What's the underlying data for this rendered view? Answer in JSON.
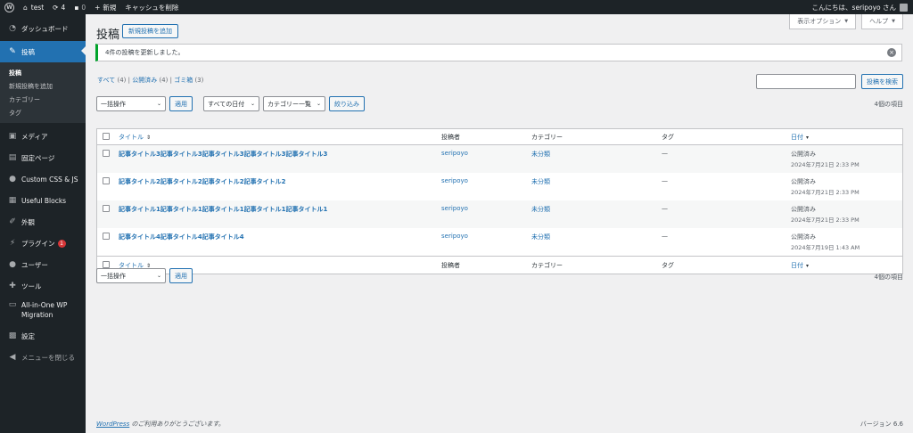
{
  "adminbar": {
    "site_name": "test",
    "updates_count": "4",
    "comments_count": "0",
    "new_label": "新規",
    "cache_label": "キャッシュを削除",
    "greeting": "こんにちは、seripoyo さん"
  },
  "sidebar": {
    "items": [
      {
        "label": "ダッシュボード",
        "icon": "dashboard-icon"
      },
      {
        "label": "投稿",
        "icon": "pin-icon"
      },
      {
        "label": "メディア",
        "icon": "media-icon"
      },
      {
        "label": "固定ページ",
        "icon": "page-icon"
      },
      {
        "label": "Custom CSS & JS",
        "icon": "code-icon"
      },
      {
        "label": "Useful Blocks",
        "icon": "blocks-icon"
      },
      {
        "label": "外観",
        "icon": "brush-icon"
      },
      {
        "label": "プラグイン",
        "icon": "plugin-icon",
        "badge": "1"
      },
      {
        "label": "ユーザー",
        "icon": "user-icon"
      },
      {
        "label": "ツール",
        "icon": "wrench-icon"
      },
      {
        "label": "All-in-One WP Migration",
        "icon": "migration-icon"
      },
      {
        "label": "設定",
        "icon": "settings-icon"
      }
    ],
    "submenu": [
      "投稿",
      "新規投稿を追加",
      "カテゴリー",
      "タグ"
    ],
    "collapse_label": "メニューを閉じる"
  },
  "header": {
    "title": "投稿",
    "add_new": "新規投稿を追加",
    "screen_options": "表示オプション",
    "help": "ヘルプ"
  },
  "notice": {
    "text": "4件の投稿を更新しました。"
  },
  "filters": {
    "all": "すべて",
    "all_count": "(4)",
    "published": "公開済み",
    "published_count": "(4)",
    "trash": "ゴミ箱",
    "trash_count": "(3)",
    "search_button": "投稿を検索",
    "bulk_action": "一括操作",
    "apply": "適用",
    "all_dates": "すべての日付",
    "category_select": "カテゴリー一覧",
    "filter_button": "絞り込み",
    "items_count": "4個の項目"
  },
  "table": {
    "columns": {
      "title": "タイトル",
      "author": "投稿者",
      "category": "カテゴリー",
      "tags": "タグ",
      "date": "日付"
    },
    "rows": [
      {
        "title": "記事タイトル3記事タイトル3記事タイトル3記事タイトル3記事タイトル3",
        "author": "seripoyo",
        "category": "未分類",
        "tags": "—",
        "status": "公開済み",
        "date": "2024年7月21日 2:33 PM"
      },
      {
        "title": "記事タイトル2記事タイトル2記事タイトル2記事タイトル2",
        "author": "seripoyo",
        "category": "未分類",
        "tags": "—",
        "status": "公開済み",
        "date": "2024年7月21日 2:33 PM"
      },
      {
        "title": "記事タイトル1記事タイトル1記事タイトル1記事タイトル1記事タイトル1",
        "author": "seripoyo",
        "category": "未分類",
        "tags": "—",
        "status": "公開済み",
        "date": "2024年7月21日 2:33 PM"
      },
      {
        "title": "記事タイトル4記事タイトル4記事タイトル4",
        "author": "seripoyo",
        "category": "未分類",
        "tags": "—",
        "status": "公開済み",
        "date": "2024年7月19日 1:43 AM"
      }
    ]
  },
  "footer": {
    "wp_link": "WordPress",
    "thanks": " のご利用ありがとうございます。",
    "version": "バージョン 6.6"
  },
  "colors": {
    "accent": "#2271b1",
    "sidebar": "#1d2327",
    "notice_success": "#00a32a",
    "badge": "#d63638"
  }
}
